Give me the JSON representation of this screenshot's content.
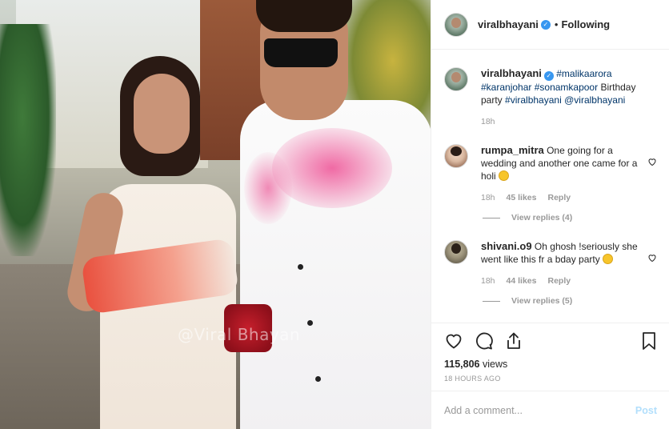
{
  "media": {
    "watermark": "@Viral Bhayan"
  },
  "header": {
    "username": "viralbhayani",
    "separator": "•",
    "follow_status": "Following"
  },
  "caption": {
    "username": "viralbhayani",
    "hashtags": [
      "#malikaarora",
      "#karanjohar",
      "#sonamkapoor"
    ],
    "text_birthday": "Birthday party",
    "tag_viral": "#viralbhayani",
    "mention": "@viralbhayani",
    "time": "18h"
  },
  "comments": [
    {
      "username": "rumpa_mitra",
      "text": "One going for a wedding and another one came for a holi",
      "emoji": "grinning-emoji",
      "time": "18h",
      "likes": "45 likes",
      "reply": "Reply",
      "view_replies": "View replies (4)"
    },
    {
      "username": "shivani.o9",
      "text": "Oh ghosh !seriously she went like this fr a bday party",
      "emoji": "flushed-emoji",
      "time": "18h",
      "likes": "44 likes",
      "reply": "Reply",
      "view_replies": "View replies (5)"
    }
  ],
  "actions": {
    "icons": [
      "heart-icon",
      "comment-icon",
      "share-icon",
      "bookmark-icon"
    ],
    "views_count": "115,806",
    "views_label": "views",
    "age": "18 HOURS AGO"
  },
  "add_comment": {
    "placeholder": "Add a comment...",
    "post_label": "Post"
  },
  "colors": {
    "verified": "#3897f0",
    "hashtag": "#003569",
    "post_disabled": "#b2dffc"
  }
}
